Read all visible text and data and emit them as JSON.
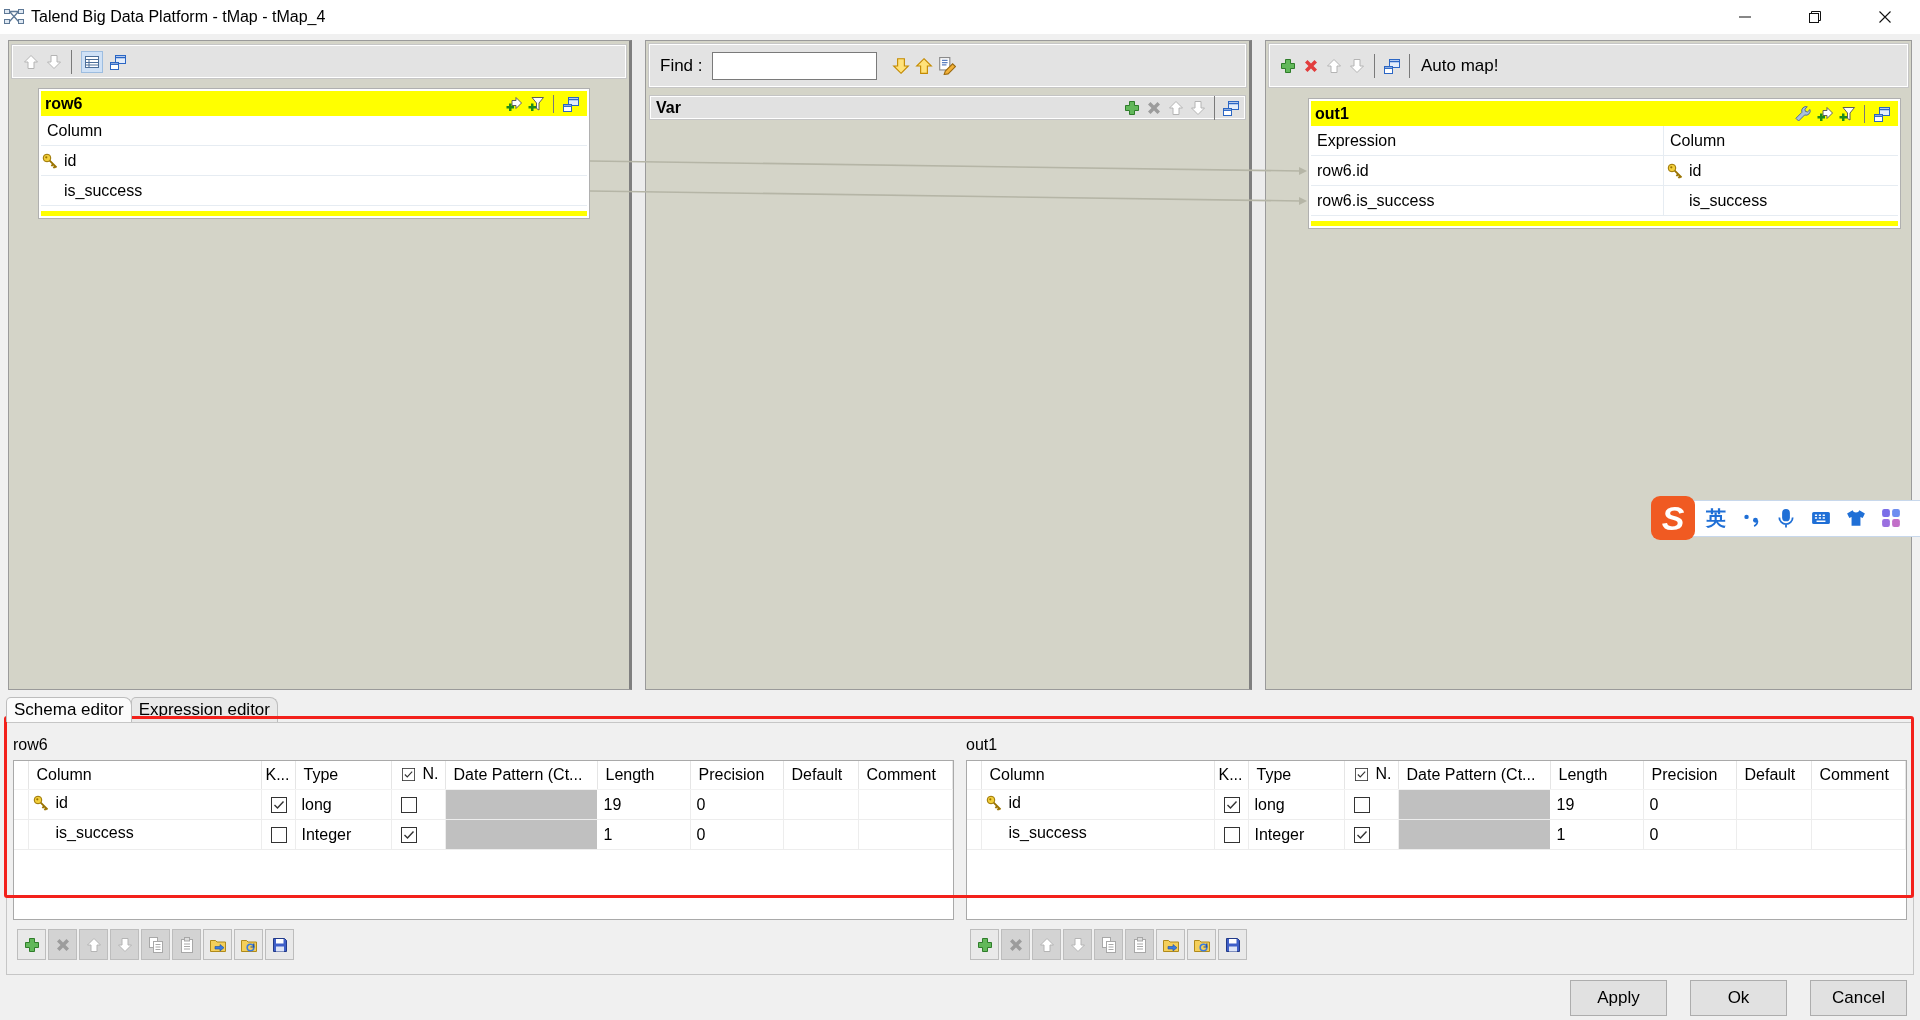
{
  "window": {
    "title": "Talend Big Data Platform - tMap - tMap_4"
  },
  "input_panel": {
    "toolbar": [
      {
        "kind": "up",
        "disabled": true,
        "pressed": false
      },
      {
        "kind": "down",
        "disabled": true,
        "pressed": false
      },
      {
        "kind": "separator"
      },
      {
        "kind": "table-view",
        "disabled": false,
        "pressed": true
      },
      {
        "kind": "minimize",
        "disabled": false,
        "pressed": false
      }
    ],
    "tables": [
      {
        "name": "row6",
        "column_header": "Column",
        "rows": [
          {
            "column": "id",
            "key": true
          },
          {
            "column": "is_success",
            "key": false
          }
        ]
      }
    ]
  },
  "var_panel": {
    "find_label": "Find :",
    "find_tools": [
      {
        "kind": "find-down"
      },
      {
        "kind": "find-up"
      },
      {
        "kind": "highlight"
      }
    ],
    "var_table": {
      "name": "Var",
      "tools": [
        {
          "kind": "add",
          "disabled": false
        },
        {
          "kind": "remove",
          "disabled": true
        },
        {
          "kind": "up",
          "disabled": true
        },
        {
          "kind": "down",
          "disabled": true
        },
        {
          "kind": "separator"
        },
        {
          "kind": "minimize",
          "disabled": false
        }
      ]
    }
  },
  "output_panel": {
    "toolbar": [
      {
        "kind": "add",
        "disabled": false
      },
      {
        "kind": "remove",
        "disabled": false
      },
      {
        "kind": "up",
        "disabled": true
      },
      {
        "kind": "down",
        "disabled": true
      },
      {
        "kind": "separator"
      },
      {
        "kind": "minimize",
        "disabled": false
      },
      {
        "kind": "separator"
      }
    ],
    "auto_map_label": "Auto map!",
    "tables": [
      {
        "name": "out1",
        "columns": [
          "Expression",
          "Column"
        ],
        "rows": [
          {
            "expression": "row6.id",
            "column": "id",
            "key": true
          },
          {
            "expression": "row6.is_success",
            "column": "is_success",
            "key": false
          }
        ]
      }
    ]
  },
  "bottom_tabs": [
    {
      "label": "Schema editor",
      "selected": true
    },
    {
      "label": "Expression editor",
      "selected": false
    }
  ],
  "schema_editors": [
    {
      "title": "row6",
      "columns": [
        {
          "label": "Column",
          "kind": "text"
        },
        {
          "label": "K...",
          "kind": "text"
        },
        {
          "label": "Type",
          "kind": "text"
        },
        {
          "label": "N.",
          "kind": "checkbox",
          "checked": true
        },
        {
          "label": "Date Pattern (Ct...",
          "kind": "text"
        },
        {
          "label": "Length",
          "kind": "text"
        },
        {
          "label": "Precision",
          "kind": "text"
        },
        {
          "label": "Default",
          "kind": "text"
        },
        {
          "label": "Comment",
          "kind": "text"
        }
      ],
      "rows": [
        {
          "column": "id",
          "key": true,
          "type": "long",
          "nullable": false,
          "date_pattern_disabled": true,
          "length": "19",
          "precision": "0"
        },
        {
          "column": "is_success",
          "key": false,
          "type": "Integer",
          "nullable": true,
          "date_pattern_disabled": true,
          "length": "1",
          "precision": "0"
        }
      ],
      "toolbar": [
        {
          "kind": "add",
          "disabled": false
        },
        {
          "kind": "remove",
          "disabled": true
        },
        {
          "kind": "up",
          "disabled": true
        },
        {
          "kind": "down",
          "disabled": true
        },
        {
          "kind": "copy",
          "disabled": true
        },
        {
          "kind": "paste",
          "disabled": true
        },
        {
          "kind": "import",
          "disabled": false
        },
        {
          "kind": "export",
          "disabled": false
        },
        {
          "kind": "save",
          "disabled": false
        }
      ]
    },
    {
      "title": "out1",
      "columns": [
        {
          "label": "Column",
          "kind": "text"
        },
        {
          "label": "K...",
          "kind": "text"
        },
        {
          "label": "Type",
          "kind": "text"
        },
        {
          "label": "N.",
          "kind": "checkbox",
          "checked": true
        },
        {
          "label": "Date Pattern (Ct...",
          "kind": "text"
        },
        {
          "label": "Length",
          "kind": "text"
        },
        {
          "label": "Precision",
          "kind": "text"
        },
        {
          "label": "Default",
          "kind": "text"
        },
        {
          "label": "Comment",
          "kind": "text"
        }
      ],
      "rows": [
        {
          "column": "id",
          "key": true,
          "type": "long",
          "nullable": false,
          "date_pattern_disabled": true,
          "length": "19",
          "precision": "0"
        },
        {
          "column": "is_success",
          "key": false,
          "type": "Integer",
          "nullable": true,
          "date_pattern_disabled": true,
          "length": "1",
          "precision": "0"
        }
      ],
      "toolbar": [
        {
          "kind": "add",
          "disabled": false
        },
        {
          "kind": "remove",
          "disabled": true
        },
        {
          "kind": "up",
          "disabled": true
        },
        {
          "kind": "down",
          "disabled": true
        },
        {
          "kind": "copy",
          "disabled": true
        },
        {
          "kind": "paste",
          "disabled": true
        },
        {
          "kind": "import",
          "disabled": false
        },
        {
          "kind": "export",
          "disabled": false
        },
        {
          "kind": "save",
          "disabled": false
        }
      ]
    }
  ],
  "ime_toolbar": {
    "logo": "S",
    "mode": "英"
  },
  "buttons": [
    {
      "label": "Apply"
    },
    {
      "label": "Ok"
    },
    {
      "label": "Cancel"
    }
  ]
}
